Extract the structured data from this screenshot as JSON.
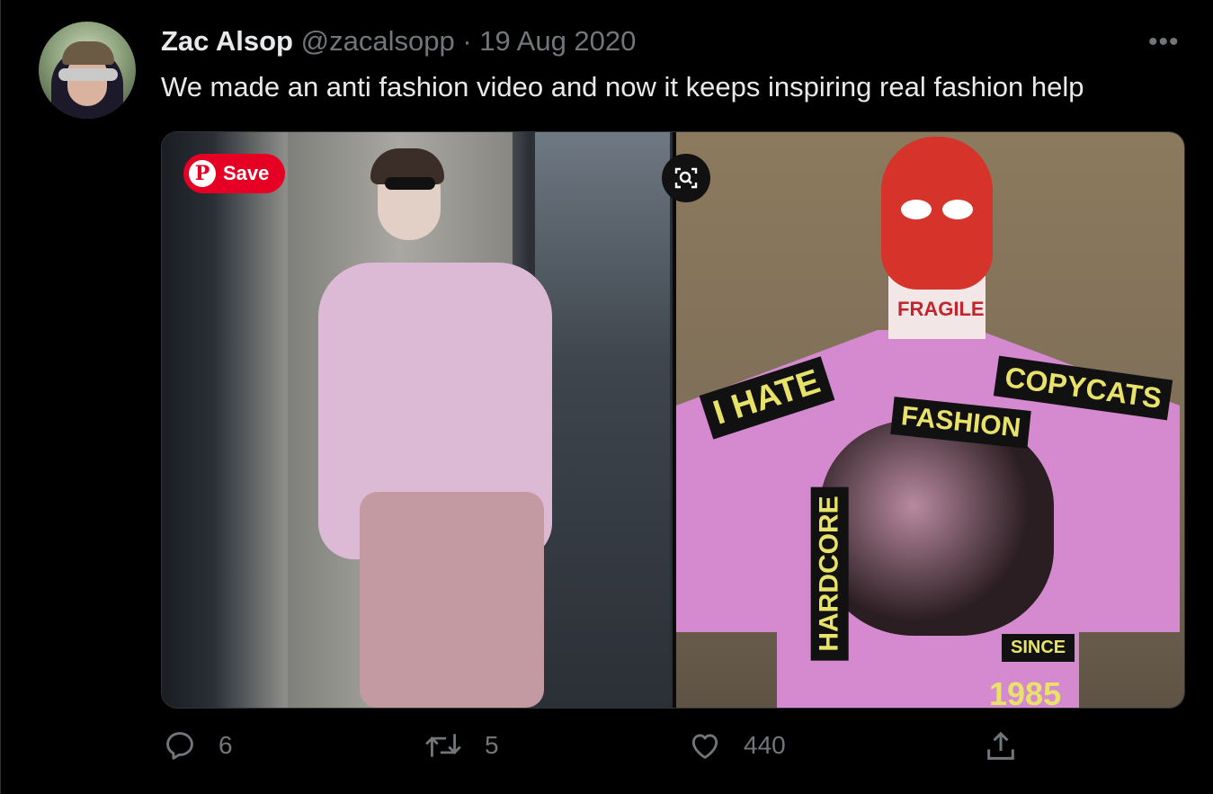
{
  "tweet": {
    "author_name": "Zac Alsop",
    "handle": "@zacalsopp",
    "separator": "·",
    "date": "19 Aug 2020",
    "more_label": "•••",
    "text": "We made an anti fashion video and now it keeps inspiring real fashion help"
  },
  "media": {
    "pinterest_save_label": "Save",
    "pinterest_logo_glyph": "P",
    "right_image_texts": {
      "label1": "I HATE",
      "label2": "COPYCATS",
      "label3": "FASHION",
      "label4": "HARDCORE",
      "label5": "SINCE",
      "label6": "1985",
      "label7": "FRAGILE"
    }
  },
  "actions": {
    "reply_count": "6",
    "retweet_count": "5",
    "like_count": "440"
  },
  "icons": {
    "reply": "reply-icon",
    "retweet": "retweet-icon",
    "like": "heart-icon",
    "share": "share-icon",
    "lens": "visual-search-icon",
    "more": "more-icon"
  },
  "colors": {
    "background": "#000000",
    "text": "#e7e9ea",
    "secondary": "#71767b",
    "pinterest_red": "#e60023"
  }
}
